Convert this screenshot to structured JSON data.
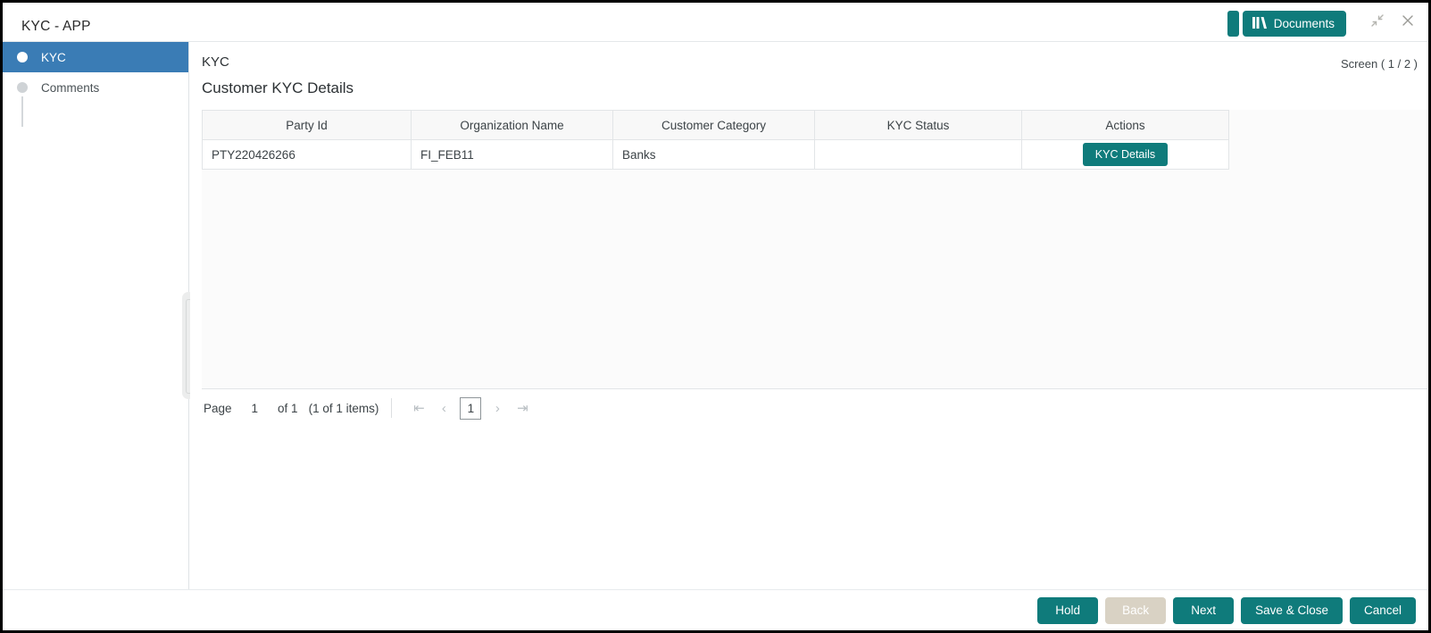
{
  "window": {
    "app_title": "KYC - APP",
    "documents_button": "Documents",
    "documents_icon": "books-icon",
    "collapse_icon": "collapse-arrows-icon",
    "close_icon": "close-icon"
  },
  "sidebar": {
    "items": [
      {
        "label": "KYC",
        "active": true
      },
      {
        "label": "Comments",
        "active": false
      }
    ]
  },
  "content": {
    "breadcrumb": "KYC",
    "screen_indicator": "Screen ( 1 / 2 )",
    "page_title": "Customer KYC Details"
  },
  "table": {
    "columns": [
      "Party Id",
      "Organization Name",
      "Customer Category",
      "KYC Status",
      "Actions"
    ],
    "rows": [
      {
        "party_id": "PTY220426266",
        "organization_name": "FI_FEB11",
        "customer_category": "Banks",
        "kyc_status": "",
        "action_label": "KYC Details"
      }
    ]
  },
  "pager": {
    "page_label": "Page",
    "page_number": "1",
    "of_label": "of 1",
    "items_label": "(1 of 1 items)",
    "first_icon": "first-page-icon",
    "prev_icon": "prev-page-icon",
    "current_page": "1",
    "next_icon": "next-page-icon",
    "last_icon": "last-page-icon"
  },
  "footer": {
    "buttons": [
      {
        "label": "Hold",
        "disabled": false
      },
      {
        "label": "Back",
        "disabled": true
      },
      {
        "label": "Next",
        "disabled": false
      },
      {
        "label": "Save & Close",
        "disabled": false
      },
      {
        "label": "Cancel",
        "disabled": false
      }
    ]
  },
  "colors": {
    "teal": "#0f7b7b",
    "active_blue": "#3a7cb5",
    "disabled_beige": "#d9d2c4"
  }
}
